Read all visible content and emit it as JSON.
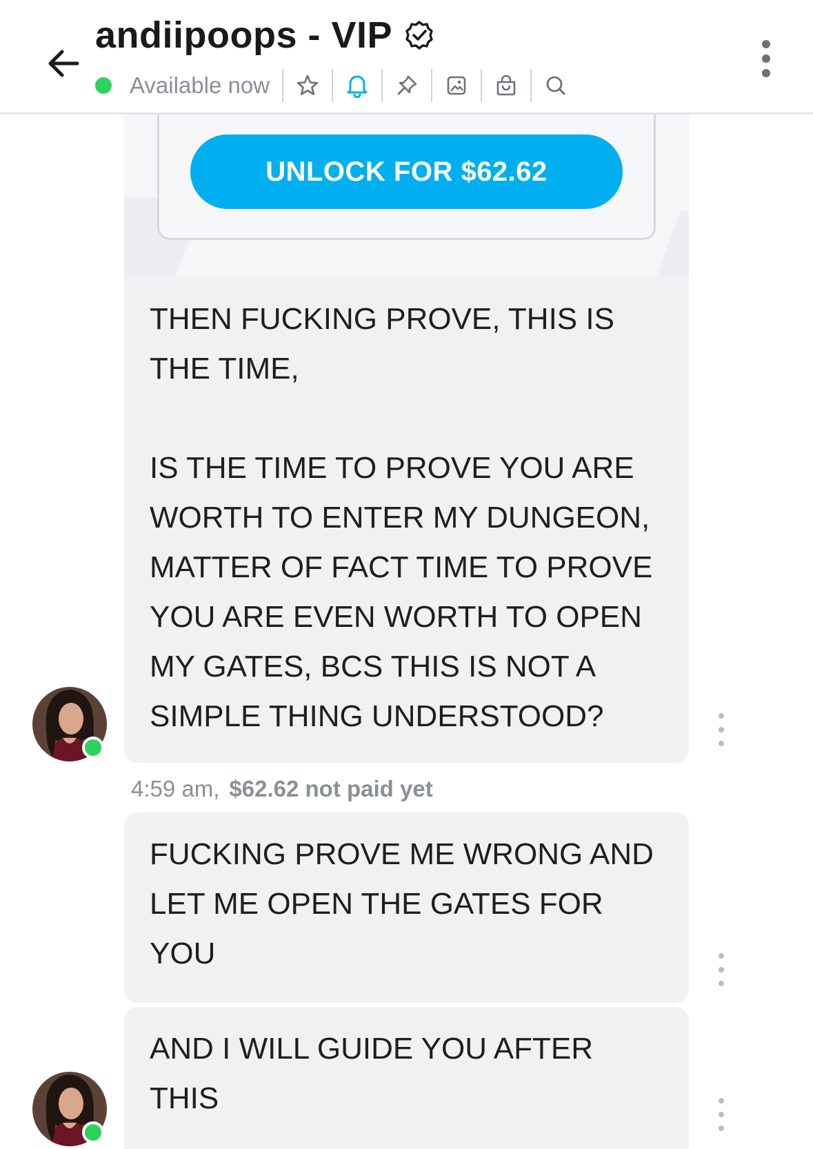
{
  "header": {
    "title": "andiipoops - VIP",
    "status": "Available now",
    "toolbar": [
      {
        "icon": "star-icon"
      },
      {
        "icon": "bell-icon"
      },
      {
        "icon": "pin-icon"
      },
      {
        "icon": "image-icon"
      },
      {
        "icon": "bag-icon"
      },
      {
        "icon": "search-icon"
      }
    ]
  },
  "colors": {
    "accent": "#00aff0",
    "online": "#2dd35a",
    "bubble": "#f0f1f3",
    "muted": "#8a9096"
  },
  "media": {
    "unlock_label": "UNLOCK FOR $62.62"
  },
  "messages": [
    {
      "lines": [
        "THEN FUCKING PROVE, THIS IS",
        "THE TIME,",
        "",
        "IS THE TIME TO PROVE YOU ARE",
        "WORTH TO ENTER MY DUNGEON,",
        "MATTER OF FACT TIME TO PROVE",
        "YOU ARE EVEN WORTH TO OPEN",
        "MY GATES, BCS THIS IS NOT A",
        "SIMPLE THING UNDERSTOOD?"
      ],
      "time": "4:59 am,",
      "price_status": "$62.62 not paid yet"
    },
    {
      "lines": [
        "FUCKING PROVE ME WRONG AND",
        "LET ME OPEN THE GATES FOR",
        "YOU"
      ]
    },
    {
      "lines": [
        "AND I WILL GUIDE YOU AFTER",
        "THIS"
      ]
    }
  ]
}
